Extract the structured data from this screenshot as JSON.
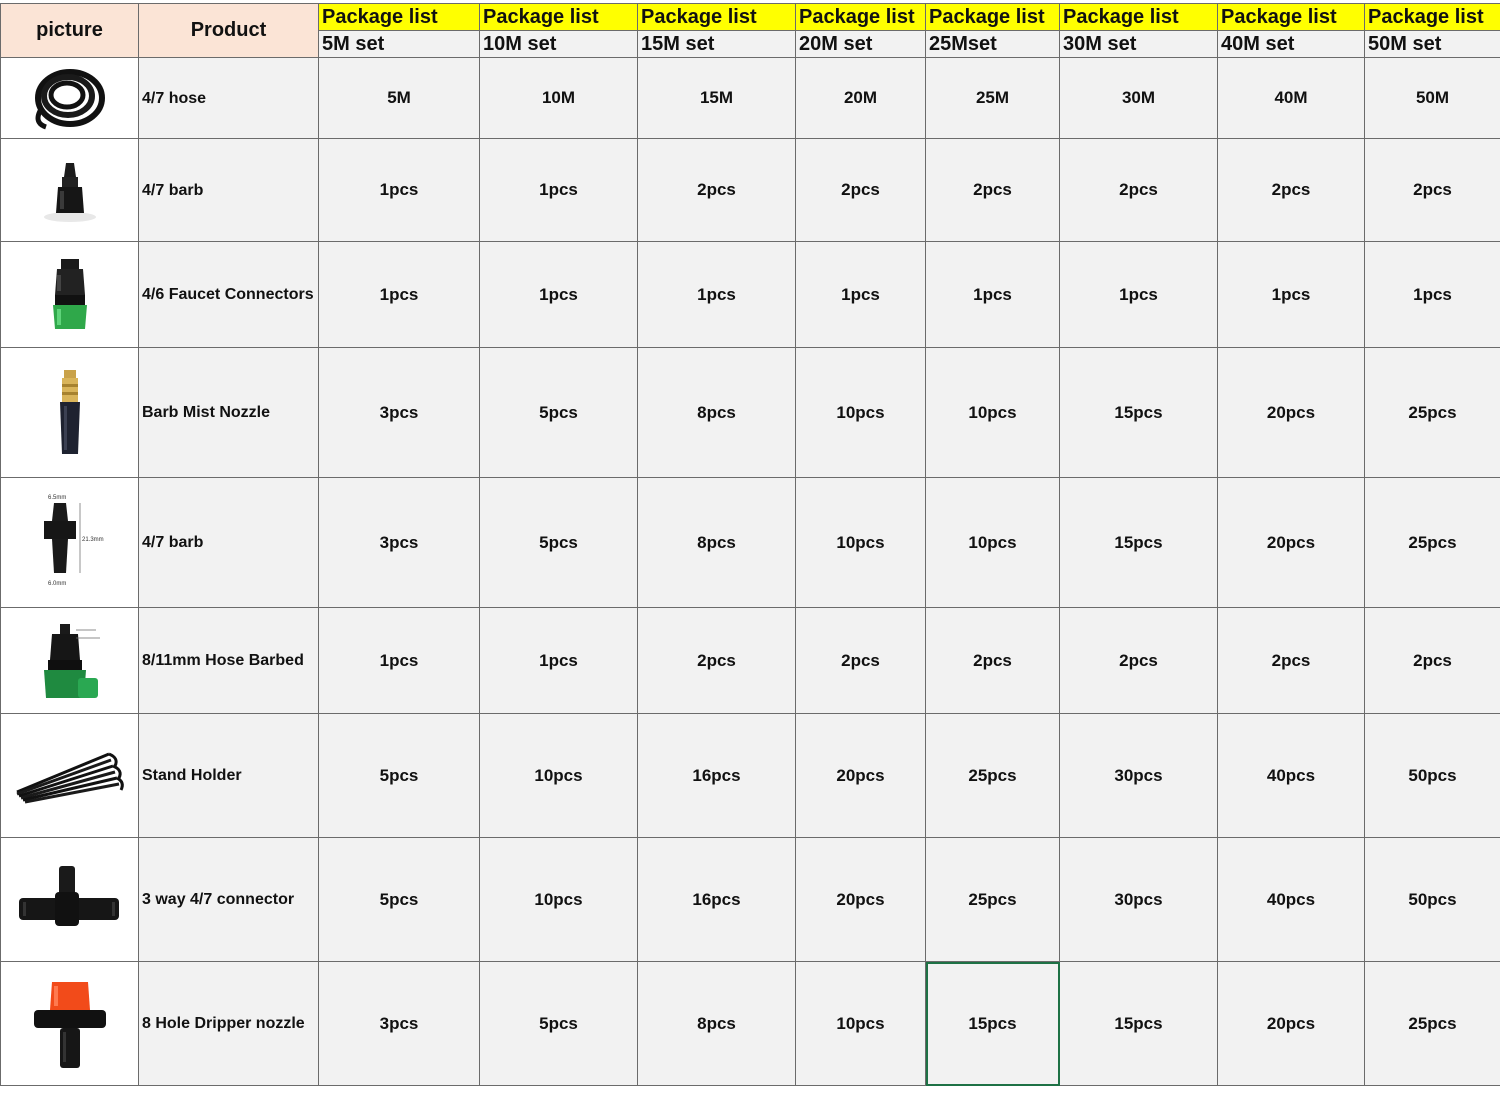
{
  "header": {
    "picture": "picture",
    "product": "Product",
    "package_label": "Package list",
    "sets": [
      "5M set",
      "10M set",
      "15M set",
      "20M set",
      "25Mset",
      "30M set",
      "40M set",
      "50M set"
    ]
  },
  "rows": [
    {
      "product": "4/7 hose",
      "icon": "hose-coil-icon",
      "qty": [
        "5M",
        "10M",
        "15M",
        "20M",
        "25M",
        "30M",
        "40M",
        "50M"
      ]
    },
    {
      "product": "4/7 barb",
      "icon": "barb-connector-icon",
      "qty": [
        "1pcs",
        "1pcs",
        "2pcs",
        "2pcs",
        "2pcs",
        "2pcs",
        "2pcs",
        "2pcs"
      ]
    },
    {
      "product": "4/6 Faucet Connectors",
      "icon": "faucet-connector-icon",
      "qty": [
        "1pcs",
        "1pcs",
        "1pcs",
        "1pcs",
        "1pcs",
        "1pcs",
        "1pcs",
        "1pcs"
      ]
    },
    {
      "product": "Barb Mist Nozzle",
      "icon": "mist-nozzle-icon",
      "qty": [
        "3pcs",
        "5pcs",
        "8pcs",
        "10pcs",
        "10pcs",
        "15pcs",
        "20pcs",
        "25pcs"
      ]
    },
    {
      "product": "4/7 barb",
      "icon": "barb-dimension-icon",
      "dimensions": [
        "6.5mm",
        "21.3mm",
        "6.0mm"
      ],
      "qty": [
        "3pcs",
        "5pcs",
        "8pcs",
        "10pcs",
        "10pcs",
        "15pcs",
        "20pcs",
        "25pcs"
      ]
    },
    {
      "product": "8/11mm Hose Barbed",
      "icon": "hose-barbed-connector-icon",
      "qty": [
        "1pcs",
        "1pcs",
        "2pcs",
        "2pcs",
        "2pcs",
        "2pcs",
        "2pcs",
        "2pcs"
      ]
    },
    {
      "product": "Stand Holder",
      "icon": "stand-holder-icon",
      "qty": [
        "5pcs",
        "10pcs",
        "16pcs",
        "20pcs",
        "25pcs",
        "30pcs",
        "40pcs",
        "50pcs"
      ]
    },
    {
      "product": "3 way 4/7 connector",
      "icon": "tee-connector-icon",
      "qty": [
        "5pcs",
        "10pcs",
        "16pcs",
        "20pcs",
        "25pcs",
        "30pcs",
        "40pcs",
        "50pcs"
      ]
    },
    {
      "product": "8 Hole Dripper nozzle",
      "icon": "dripper-nozzle-icon",
      "qty": [
        "3pcs",
        "5pcs",
        "8pcs",
        "10pcs",
        "15pcs",
        "15pcs",
        "20pcs",
        "25pcs"
      ]
    }
  ],
  "colors": {
    "header_picture_bg": "#fbe4d6",
    "header_package_bg": "#ffff00",
    "cell_bg": "#f2f2f2",
    "selection_border": "#1e7145"
  }
}
